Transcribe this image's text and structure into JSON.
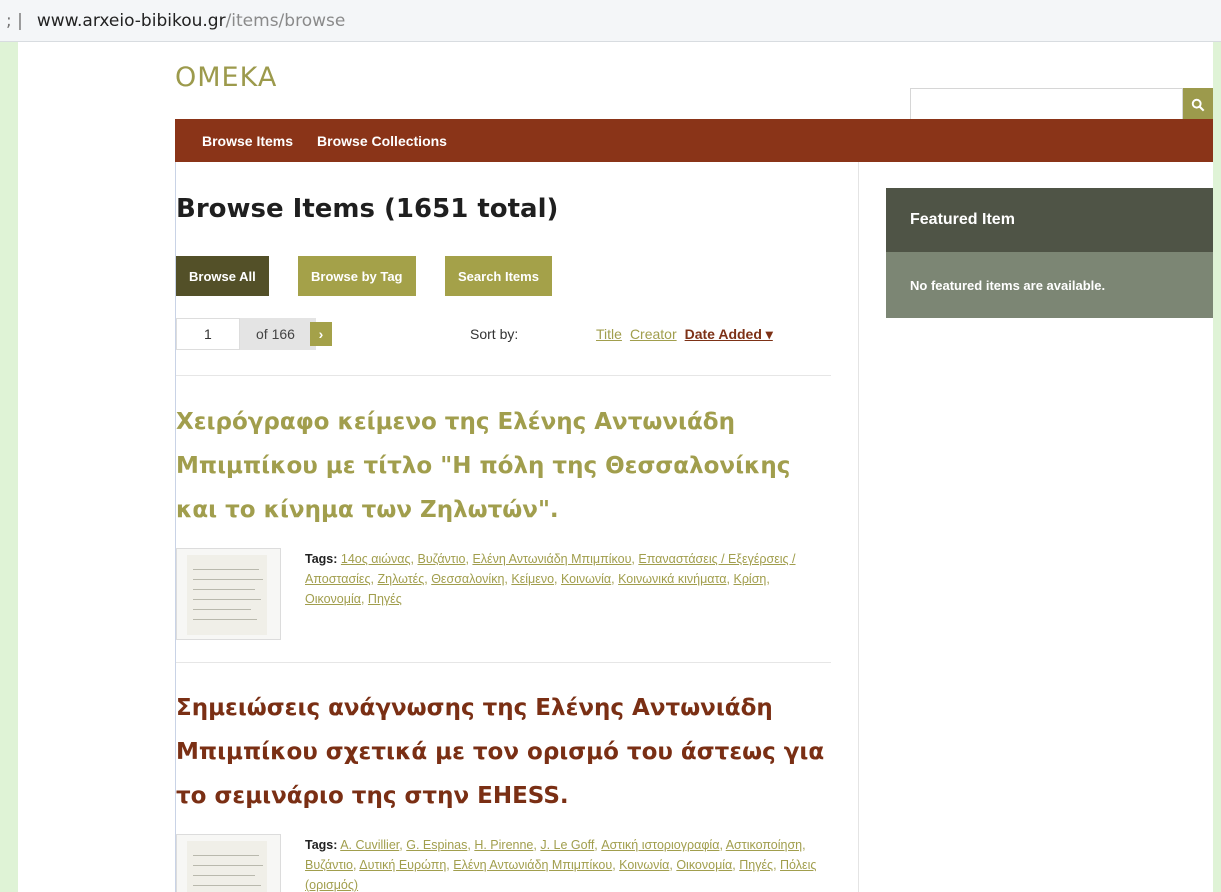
{
  "browser": {
    "sep": "; |",
    "domain": "www.arxeio-bibikou.gr",
    "path": "/items/browse"
  },
  "site": {
    "logo": "OMEKA",
    "search_placeholder": "",
    "nav": [
      "Browse Items",
      "Browse Collections"
    ]
  },
  "main": {
    "title": "Browse Items (1651 total)",
    "buttons": [
      "Browse All",
      "Browse by Tag",
      "Search Items"
    ],
    "pager": {
      "page": "1",
      "of_total": "of 166",
      "next": "›"
    },
    "sort": {
      "label": "Sort by:",
      "options": [
        "Title",
        "Creator",
        "Date Added ▾"
      ]
    },
    "items": [
      {
        "title": "Χειρόγραφο κείμενο της Ελένης Αντωνιάδη Μπιμπίκου με τίτλο \"Η πόλη της Θεσσαλονίκης και το κίνημα των Ζηλωτών\".",
        "tags_label": "Tags:",
        "tags": [
          "14ος αιώνας",
          "Βυζάντιο",
          "Ελένη Αντωνιάδη Μπιμπίκου",
          "Επαναστάσεις / Εξεγέρσεις / Αποστασίες",
          "Ζηλωτές",
          "Θεσσαλονίκη",
          "Κείμενο",
          "Κοινωνία",
          "Κοινωνικά κινήματα",
          "Κρίση",
          "Οικονομία",
          "Πηγές"
        ]
      },
      {
        "title": "Σημειώσεις ανάγνωσης της Ελένης Αντωνιάδη Μπιμπίκου σχετικά με τον ορισμό του άστεως για το σεμινάριο της στην EHESS.",
        "tags_label": "Tags:",
        "tags": [
          "A. Cuvillier",
          "G. Espinas",
          "H. Pirenne",
          "J. Le Goff",
          "Αστική ιστοριογραφία",
          "Αστικοποίηση",
          "Βυζάντιο",
          "Δυτική Ευρώπη",
          "Ελένη Αντωνιάδη Μπιμπίκου",
          "Κοινωνία",
          "Οικονομία",
          "Πηγές",
          "Πόλεις (ορισμός)"
        ]
      }
    ]
  },
  "sidebar": {
    "featured_title": "Featured Item",
    "featured_empty": "No featured items are available."
  }
}
